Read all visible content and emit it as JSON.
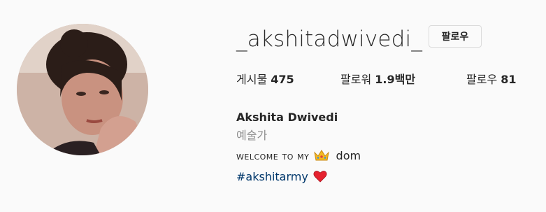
{
  "profile": {
    "username": "_akshitadwivedi_",
    "follow_label": "팔로우"
  },
  "stats": {
    "posts_label": "게시물",
    "posts_count": "475",
    "followers_label": "팔로워",
    "followers_count": "1.9백만",
    "following_label": "팔로우",
    "following_count": "81"
  },
  "bio": {
    "full_name": "Akshita Dwivedi",
    "category": "예술가",
    "line1_prefix": "welcome to my",
    "line1_icon": "crown-emoji",
    "line1_suffix": "dom",
    "hashtag": "#akshitarmy",
    "hashtag_icon": "red-heart-emoji"
  },
  "colors": {
    "background": "#fafafa",
    "text": "#262626",
    "secondary_text": "#8e8e8e",
    "link": "#00376b",
    "border": "#dbdbdb"
  }
}
